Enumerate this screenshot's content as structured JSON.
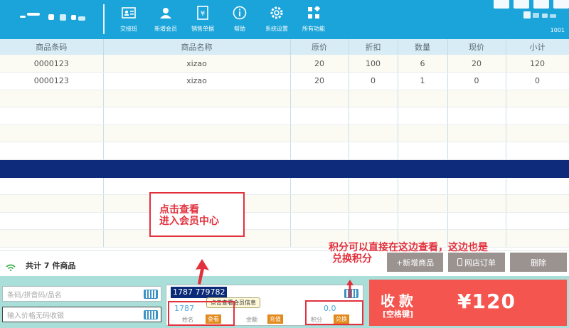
{
  "header": {
    "nav": [
      {
        "label": "交接班",
        "icon": "id-card-icon"
      },
      {
        "label": "新增会员",
        "icon": "user-add-icon"
      },
      {
        "label": "销售单据",
        "icon": "receipt-icon"
      },
      {
        "label": "帮助",
        "icon": "info-icon"
      },
      {
        "label": "系统设置",
        "icon": "gear-icon"
      },
      {
        "label": "所有功能",
        "icon": "grid-icon"
      }
    ],
    "user_id": "1001"
  },
  "table": {
    "columns": [
      "商品条码",
      "商品名称",
      "原价",
      "折扣",
      "数量",
      "现价",
      "小计"
    ],
    "rows": [
      [
        "0000123",
        "xizao",
        "20",
        "100",
        "6",
        "20",
        "120"
      ],
      [
        "0000123",
        "xizao",
        "20",
        "0",
        "1",
        "0",
        "0"
      ]
    ]
  },
  "summary": {
    "total_text": "共计 7 件商品",
    "add_product": "+新增商品",
    "online_order": "网店订单",
    "delete": "删除"
  },
  "inputs": {
    "barcode_placeholder": "条码/拼音码/品名",
    "price_placeholder": "输入价格无码收银"
  },
  "member": {
    "phone": "1787 779782",
    "phone_partial": "1787",
    "name_label": "姓名",
    "view_button": "查看",
    "balance_label": "余额",
    "recharge_button": "充值",
    "points_value": "0.0",
    "points_label": "积分",
    "redeem_button": "兑换",
    "tooltip": "点击查看会员信息"
  },
  "payment": {
    "title": "收款",
    "key_hint": "[空格键]",
    "amount": "¥120"
  },
  "annotations": {
    "member_center": [
      "点击查看",
      "进入会员中心"
    ],
    "points_note": [
      "积分可以直接在这边查看，这边也是",
      "兑换积分"
    ]
  },
  "colors": {
    "header": "#1ba4d9",
    "selected_row": "#0d2b7a",
    "pay": "#f4564f",
    "annotation": "#e2313d",
    "tag": "#e38a1c"
  }
}
